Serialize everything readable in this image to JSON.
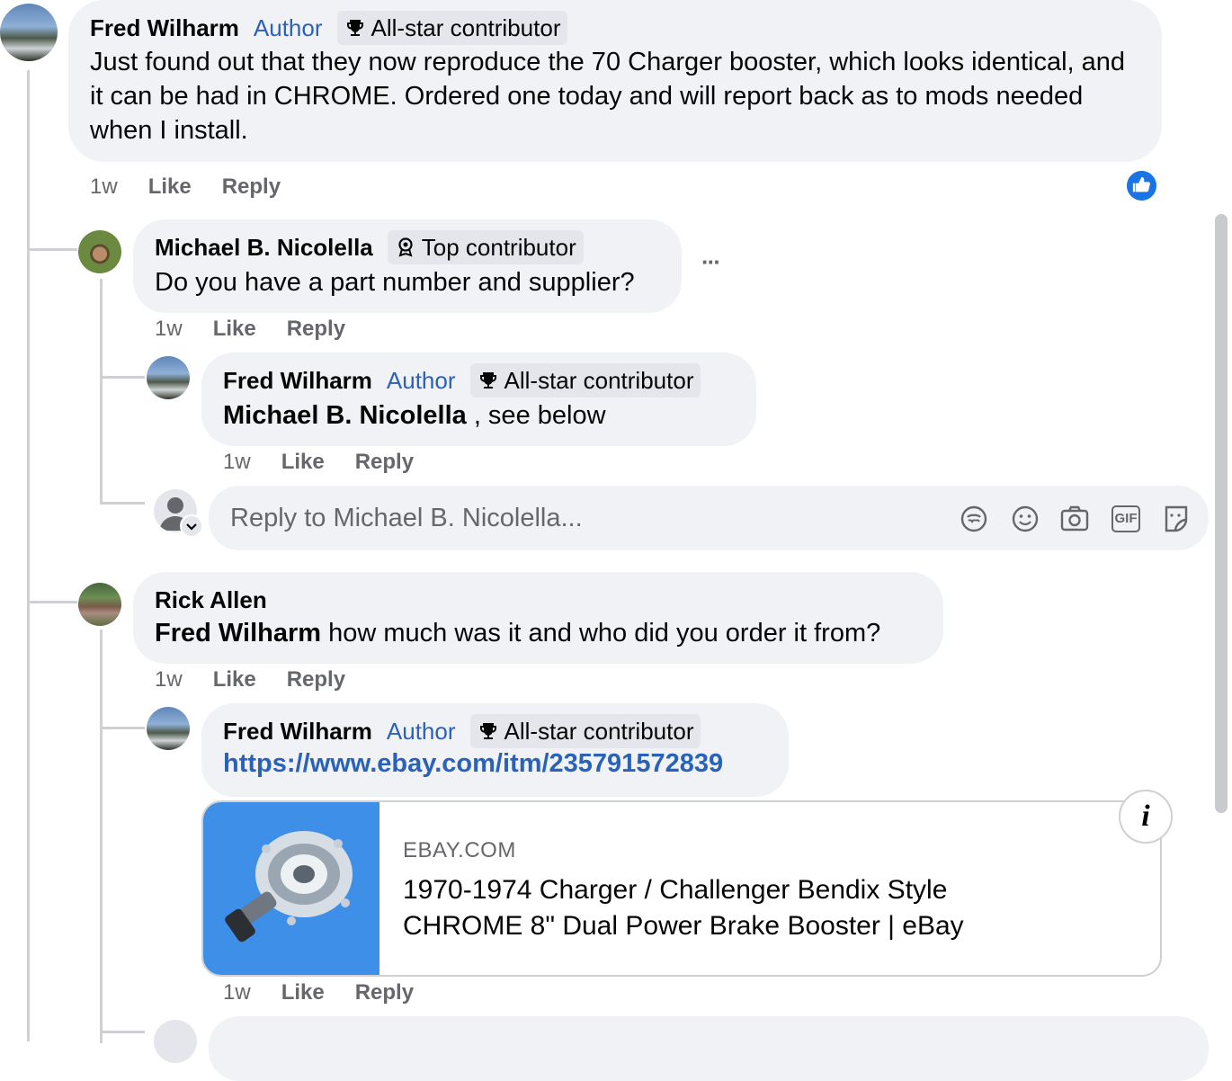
{
  "comments": {
    "c1": {
      "name": "Fred Wilharm",
      "author_label": "Author",
      "badge": "All-star contributor",
      "text": "Just found out that they now reproduce the 70 Charger booster, which looks identical, and it can be had in CHROME. Ordered one today and will report back as to mods needed when I install.",
      "time": "1w",
      "like": "Like",
      "reply": "Reply"
    },
    "c2": {
      "name": "Michael B. Nicolella",
      "badge": "Top contributor",
      "text": "Do you have a part number and supplier?",
      "more": "···",
      "time": "1w",
      "like": "Like",
      "reply": "Reply"
    },
    "c3": {
      "name": "Fred Wilharm",
      "author_label": "Author",
      "badge": "All-star contributor",
      "mention": "Michael B. Nicolella",
      "text": " , see below",
      "time": "1w",
      "like": "Like",
      "reply": "Reply"
    },
    "reply_box": {
      "placeholder": "Reply to Michael B. Nicolella..."
    },
    "c4": {
      "name": "Rick Allen",
      "mention": "Fred Wilharm",
      "text": " how much was it and who did you order it from?",
      "time": "1w",
      "like": "Like",
      "reply": "Reply"
    },
    "c5": {
      "name": "Fred Wilharm",
      "author_label": "Author",
      "badge": "All-star contributor",
      "link": "https://www.ebay.com/itm/235791572839",
      "card_domain": "EBAY.COM",
      "card_title_line1": "1970-1974 Charger / Challenger Bendix Style",
      "card_title_line2": "CHROME 8\" Dual Power Brake Booster | eBay",
      "time": "1w",
      "like": "Like",
      "reply": "Reply"
    }
  },
  "icons": {
    "like_reaction": "thumbs-up-icon",
    "trophy": "trophy-icon",
    "top_contributor": "badge-icon",
    "avatar_sticker": "avatar-sticker-icon",
    "emoji": "emoji-icon",
    "camera": "camera-icon",
    "gif": "gif-icon",
    "sticker": "sticker-icon",
    "info": "info-icon"
  },
  "gif_label": "GIF",
  "info_label": "i",
  "colors": {
    "link": "#2b62b9",
    "bubble": "#f0f2f5",
    "meta": "#65676b",
    "like_reaction": "#1b74e4"
  }
}
